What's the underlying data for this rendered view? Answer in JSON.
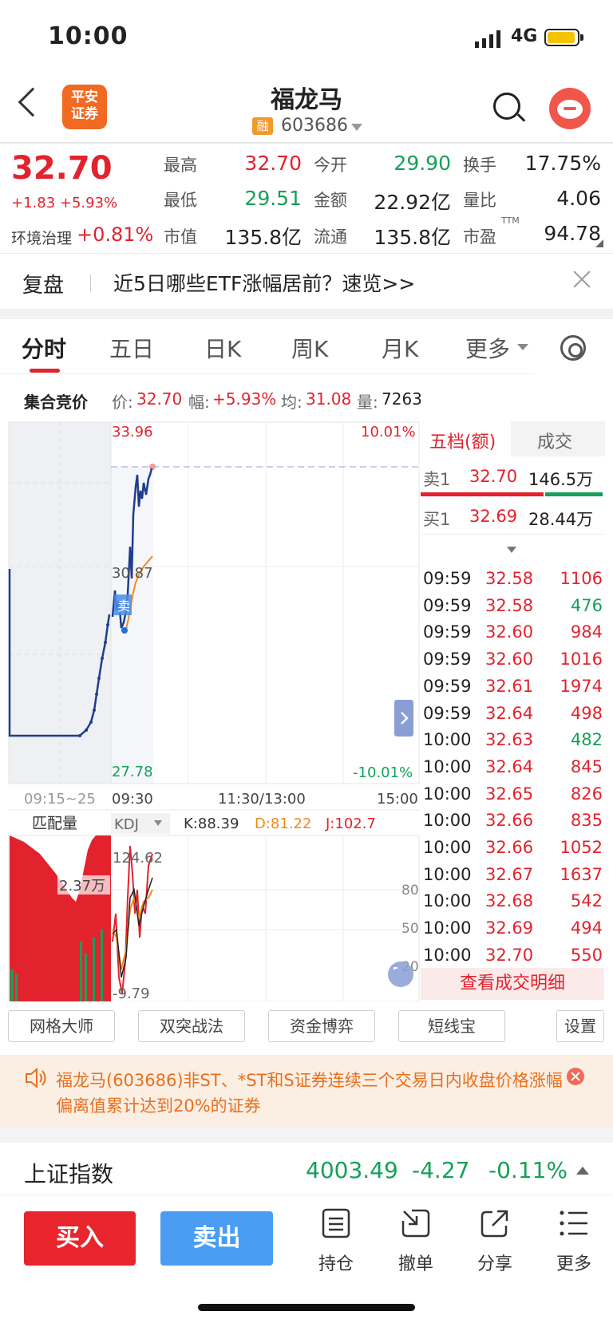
{
  "status": {
    "time": "10:00",
    "network": "4G"
  },
  "header": {
    "brand_logo_text": "平安证券",
    "stock_name": "福龙马",
    "margin_badge": "融",
    "stock_code": "603686"
  },
  "quote": {
    "last_price": "32.70",
    "change": "+1.83 +5.93%",
    "sector_label": "环境治理",
    "sector_change": "+0.81%",
    "high_label": "最高",
    "high": "32.70",
    "low_label": "最低",
    "low": "29.51",
    "mktcap_label": "市值",
    "mktcap": "135.8亿",
    "open_label": "今开",
    "open": "29.90",
    "amount_label": "金额",
    "amount": "22.92亿",
    "float_label": "流通",
    "float": "135.8亿",
    "turnover_label": "换手",
    "turnover": "17.75%",
    "volratio_label": "量比",
    "volratio": "4.06",
    "pe_label": "市盈",
    "pe_sup": "TTM",
    "pe": "94.78"
  },
  "banner": {
    "label": "复盘",
    "text": "近5日哪些ETF涨幅居前？速览>>"
  },
  "tabs": [
    "分时",
    "五日",
    "日K",
    "周K",
    "月K",
    "更多"
  ],
  "auction": {
    "title": "集合竞价",
    "price_label": "价:",
    "price": "32.70",
    "chg_label": "幅:",
    "chg": "+5.93%",
    "avg_label": "均:",
    "avg": "31.08",
    "vol_label": "量:",
    "vol": "7263"
  },
  "chart": {
    "top_price": "33.96",
    "top_pct": "10.01%",
    "mid_price": "30.87",
    "bottom_price": "27.78",
    "bottom_pct": "-10.01%",
    "time_labels": [
      "09:15~25",
      "09:30",
      "11:30/13:00",
      "15:00"
    ],
    "sell_marker": "卖",
    "match_volume_label": "匹配量",
    "match_volume_value": "2.37万",
    "indicator_name": "KDJ",
    "k": "K:88.39",
    "d": "D:81.22",
    "j": "J:102.7",
    "ind_top": "124.62",
    "ind_bottom": "-9.79",
    "ind_levels": [
      "80",
      "50",
      "20"
    ],
    "colors": {
      "price_line": "#1f3d8f",
      "avg_line": "#f08a1c",
      "up": "#e2232e",
      "down": "#16a05a"
    }
  },
  "order_book": {
    "tab_active": "五档(额)",
    "tab_trades": "成交",
    "sell1_label": "卖1",
    "sell1_price": "32.70",
    "sell1_amount": "146.5万",
    "buy1_label": "买1",
    "buy1_price": "32.69",
    "buy1_amount": "28.44万"
  },
  "trades": [
    {
      "time": "09:59",
      "price": "32.58",
      "vol": "1106",
      "dir": "up"
    },
    {
      "time": "09:59",
      "price": "32.58",
      "vol": "476",
      "dir": "down"
    },
    {
      "time": "09:59",
      "price": "32.60",
      "vol": "984",
      "dir": "up"
    },
    {
      "time": "09:59",
      "price": "32.60",
      "vol": "1016",
      "dir": "up"
    },
    {
      "time": "09:59",
      "price": "32.61",
      "vol": "1974",
      "dir": "up"
    },
    {
      "time": "09:59",
      "price": "32.64",
      "vol": "498",
      "dir": "up"
    },
    {
      "time": "10:00",
      "price": "32.63",
      "vol": "482",
      "dir": "down"
    },
    {
      "time": "10:00",
      "price": "32.64",
      "vol": "845",
      "dir": "up"
    },
    {
      "time": "10:00",
      "price": "32.65",
      "vol": "826",
      "dir": "up"
    },
    {
      "time": "10:00",
      "price": "32.66",
      "vol": "835",
      "dir": "up"
    },
    {
      "time": "10:00",
      "price": "32.66",
      "vol": "1052",
      "dir": "up"
    },
    {
      "time": "10:00",
      "price": "32.67",
      "vol": "1637",
      "dir": "up"
    },
    {
      "time": "10:00",
      "price": "32.68",
      "vol": "542",
      "dir": "up"
    },
    {
      "time": "10:00",
      "price": "32.69",
      "vol": "494",
      "dir": "up"
    },
    {
      "time": "10:00",
      "price": "32.70",
      "vol": "550",
      "dir": "up"
    }
  ],
  "trade_detail_label": "查看成交明细",
  "tools": [
    "网格大师",
    "双突战法",
    "资金博弈",
    "短线宝",
    "设置"
  ],
  "notice": "福龙马(603686)非ST、*ST和S证券连续三个交易日内收盘价格涨幅偏离值累计达到20%的证券",
  "index": {
    "name": "上证指数",
    "value": "4003.49",
    "change": "-4.27",
    "pct": "-0.11%"
  },
  "bottom": {
    "buy": "买入",
    "sell": "卖出",
    "holdings": "持仓",
    "cancel": "撤单",
    "share": "分享",
    "more": "更多"
  }
}
